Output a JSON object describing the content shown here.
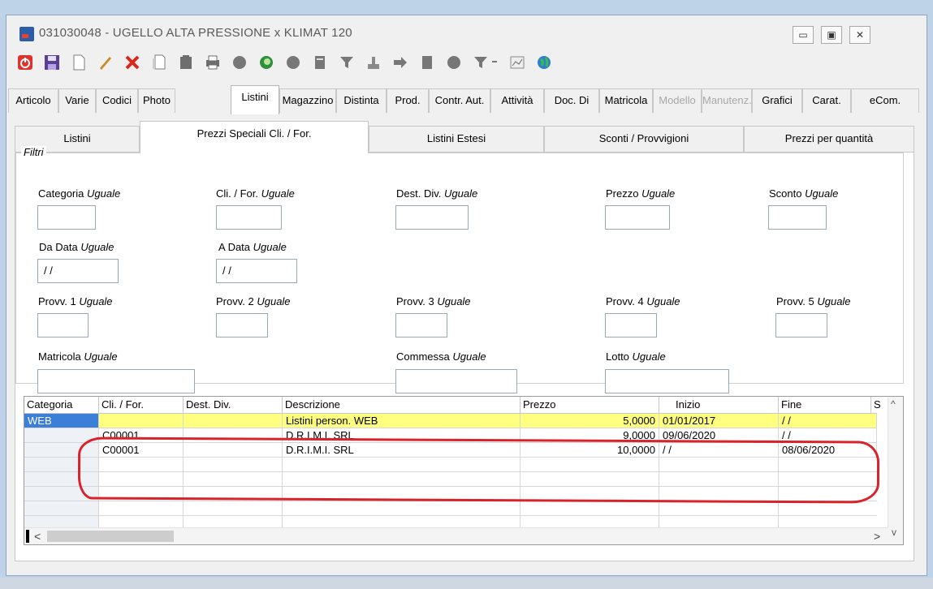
{
  "window": {
    "title": "031030048 - UGELLO ALTA PRESSIONE x KLIMAT 120",
    "controls": {
      "minimize": "▭",
      "maximize": "▣",
      "close": "✕"
    }
  },
  "toolbar": {
    "icons": [
      "power-icon",
      "save-icon",
      "new-doc-icon",
      "edit-pencil-icon",
      "delete-x-icon",
      "copy-doc-icon",
      "archive-icon",
      "print-icon",
      "circle-gray-icon",
      "circle-green-icon",
      "circle-gray-icon",
      "document-icon",
      "filter-icon",
      "stamp-icon",
      "arrow-icon",
      "book-icon",
      "circle-icon",
      "filter-dropdown-icon",
      "chart-icon",
      "globe-icon"
    ]
  },
  "main_tabs": [
    {
      "label": "Articolo"
    },
    {
      "label": "Varie"
    },
    {
      "label": "Codici"
    },
    {
      "label": "Photo"
    },
    {
      "label": "Listini"
    },
    {
      "label": "Magazzino"
    },
    {
      "label": "Distinta"
    },
    {
      "label": "Prod."
    },
    {
      "label": "Contr. Aut."
    },
    {
      "label": "Attività"
    },
    {
      "label": "Doc. Di"
    },
    {
      "label": "Matricola"
    },
    {
      "label": "Modello"
    },
    {
      "label": "Manutenz."
    },
    {
      "label": "Grafici"
    },
    {
      "label": "Carat."
    },
    {
      "label": "eCom."
    }
  ],
  "sub_tabs": [
    {
      "label": "Listini"
    },
    {
      "label": "Prezzi Speciali Cli. / For."
    },
    {
      "label": "Listini Estesi"
    },
    {
      "label": "Sconti / Provvigioni"
    },
    {
      "label": "Prezzi per quantità"
    }
  ],
  "filters": {
    "legend": "Filtri",
    "op": "Uguale",
    "categoria": "Categoria",
    "cli_for": "Cli. / For.",
    "dest_div": "Dest. Div.",
    "prezzo": "Prezzo",
    "sconto": "Sconto",
    "da_data": "Da Data",
    "a_data": "A Data",
    "date_value": " / /",
    "provv1": "Provv. 1",
    "provv2": "Provv. 2",
    "provv3": "Provv. 3",
    "provv4": "Provv. 4",
    "provv5": "Provv. 5",
    "matricola": "Matricola",
    "commessa": "Commessa",
    "lotto": "Lotto"
  },
  "grid": {
    "columns": [
      "Categoria",
      "Cli. / For.",
      "Dest. Div.",
      "Descrizione",
      "Prezzo",
      "Inizio",
      "Fine",
      "S"
    ],
    "rows": [
      {
        "categoria": "WEB",
        "cli_for": "",
        "dest_div": "",
        "descrizione": "Listini person. WEB",
        "prezzo": "5,0000",
        "inizio": "01/01/2017",
        "fine": "/ /"
      },
      {
        "categoria": "",
        "cli_for": "C00001",
        "dest_div": "",
        "descrizione": "D.R.I.M.I. SRL",
        "prezzo": "9,0000",
        "inizio": "09/06/2020",
        "fine": "/ /"
      },
      {
        "categoria": "",
        "cli_for": "C00001",
        "dest_div": "",
        "descrizione": "D.R.I.M.I. SRL",
        "prezzo": "10,0000",
        "inizio": "/ /",
        "fine": "08/06/2020"
      }
    ],
    "scroll_up": "^",
    "scroll_down": "v",
    "scroll_left": "<",
    "scroll_right": ">"
  },
  "colors": {
    "selected_row": "#ffff80",
    "selected_cell": "#3b7fd9",
    "annotation": "#d9232a"
  }
}
